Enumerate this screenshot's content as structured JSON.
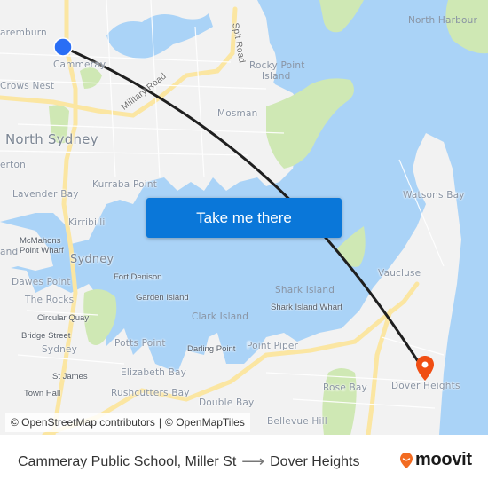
{
  "map": {
    "labels": {
      "cammeray": "Cammeray",
      "naremburn": "aremburn",
      "crows_nest": "Crows Nest",
      "north_sydney": "North Sydney",
      "military_road": "Military Road",
      "spit_road": "Spit Road",
      "mosman": "Mosman",
      "rocky_point_island_1": "Rocky Point",
      "rocky_point_island_2": "Island",
      "north_harbour": "North Harbour",
      "waverton": "erton",
      "lavender_bay": "Lavender Bay",
      "kurraba_point": "Kurraba Point",
      "kirribilli": "Kirribilli",
      "mcmahons_point_wharf_1": "McMahons",
      "mcmahons_point_wharf_2": "Point Wharf",
      "balmain_east": "and",
      "sydney_big": "Sydney",
      "fort_denison": "Fort Denison",
      "dawes_point": "Dawes Point",
      "the_rocks": "The Rocks",
      "circular_quay": "Circular Quay",
      "bridge_street": "Bridge Street",
      "sydney_cbd": "Sydney",
      "st_james": "St James",
      "town_hall": "Town Hall",
      "garden_island": "Garden Island",
      "potts_point": "Potts Point",
      "elizabeth_bay": "Elizabeth Bay",
      "rushcutters_bay": "Rushcutters Bay",
      "clark_island": "Clark Island",
      "darling_point": "Darling Point",
      "point_piper": "Point Piper",
      "double_bay": "Double Bay",
      "bellevue_hill": "Bellevue Hill",
      "shark_island": "Shark Island",
      "shark_island_wharf": "Shark Island Wharf",
      "rose_bay": "Rose Bay",
      "watsons_bay": "Watsons Bay",
      "vaucluse": "Vaucluse",
      "dover_heights": "Dover Heights"
    },
    "origin_marker": "origin-dot-icon",
    "destination_marker": "destination-pin-icon",
    "colors": {
      "water": "#aad3f7",
      "land": "#f2f2f2",
      "park": "#cfe8b4",
      "major_road": "#fbe6a2",
      "route_line": "#1f1f1f",
      "origin": "#2a6ef5",
      "destination": "#f04e13",
      "button": "#0a77d9"
    }
  },
  "cta": {
    "label": "Take me there"
  },
  "attribution": {
    "osm": "© OpenStreetMap contributors",
    "sep": "|",
    "omt": "© OpenMapTiles"
  },
  "footer": {
    "origin": "Cammeray Public School, Miller St",
    "arrow": "⟶",
    "destination": "Dover Heights",
    "brand": "moovit",
    "brand_color": "#f26b21"
  }
}
